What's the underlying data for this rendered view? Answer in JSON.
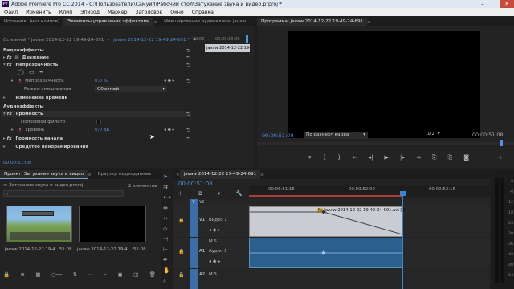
{
  "window": {
    "title": "Adobe Premiere Pro CC 2014 - C:\\Пользователи\\Самуил\\Рабочий стол\\Затухание звука и видео.prproj *",
    "app_icon_label": "Pr",
    "minimize": "–",
    "maximize": "□",
    "close": "✕"
  },
  "menu": [
    "Файл",
    "Изменить",
    "Клип",
    "Эпизод",
    "Маркер",
    "Заголовок",
    "Окно",
    "Справка"
  ],
  "effects_panel": {
    "tabs": [
      "Источник: (нет клипов)",
      "Элементы управления эффектами",
      "Микширование аудиоклипа: javaw"
    ],
    "master_label": "Основной * javaw 2014-12-22 19-49-24-691",
    "sequence_label": "javaw 2014-12-22 19-49-24-691 *",
    "ruler_times": [
      "00:00",
      "00:00:30:00"
    ],
    "clip_name": "javaw 2014-12-22 19-49-24-6",
    "video_effects": "Видеоэффекты",
    "motion": "Движение",
    "opacity": "Непрозрачность",
    "opacity_param": "Непрозрачность",
    "opacity_value": "0,0 %",
    "blend_mode_label": "Режим смешивания",
    "blend_mode_value": "Обычный",
    "time_remap": "Изменение времени",
    "audio_effects": "Аудиоэффекты",
    "volume": "Громкость",
    "bypass": "Полосовой фильтр",
    "level": "Уровень",
    "level_value": "0,0 дБ",
    "channel_volume": "Громкость канала",
    "panner": "Средство панорамирования",
    "timecode": "00:00:51:08",
    "fx_badge": "fx"
  },
  "program_monitor": {
    "tab": "Программа: javaw 2014-12-22 19-49-24-691",
    "timecode": "00:00:51:08",
    "fit": "По размеру кадра",
    "resolution": "1/2",
    "duration": "00:00:51:08"
  },
  "project_panel": {
    "tabs": [
      "Проект: Затухание звука и видео",
      "Браузер медиаданных"
    ],
    "file": "Затухание звука и видео.prproj",
    "items_count": "2 элементов",
    "items": [
      {
        "name": "javaw 2014-12-22 19-4...",
        "duration": "51:08"
      },
      {
        "name": "javaw 2014-12-22 19-4...",
        "duration": "51:08"
      }
    ]
  },
  "timeline": {
    "tab": "javaw 2014-12-22 19-49-24-691",
    "timecode": "00:00:51:08",
    "ruler": [
      "00:00:51:15",
      "00:00:52:00",
      "00:00:52:15"
    ],
    "tracks": [
      {
        "id": "V2",
        "name": ""
      },
      {
        "id": "V1",
        "name": "Видео 1"
      },
      {
        "id": "A1",
        "name": "Аудио 1"
      },
      {
        "id": "A2",
        "name": ""
      }
    ],
    "video_clip": "javaw 2014-12-22 19-49-24-691.avi [В]",
    "meter_labels": [
      "0",
      "-6",
      "-12",
      "-18",
      "-24",
      "-30",
      "-36",
      "-42",
      "-48",
      "-54"
    ]
  },
  "colors": {
    "accent_blue": "#4e93e6",
    "video_clip": "#c9ccd2",
    "audio_clip": "#2b5f8d",
    "playhead": "#3a84d6"
  }
}
